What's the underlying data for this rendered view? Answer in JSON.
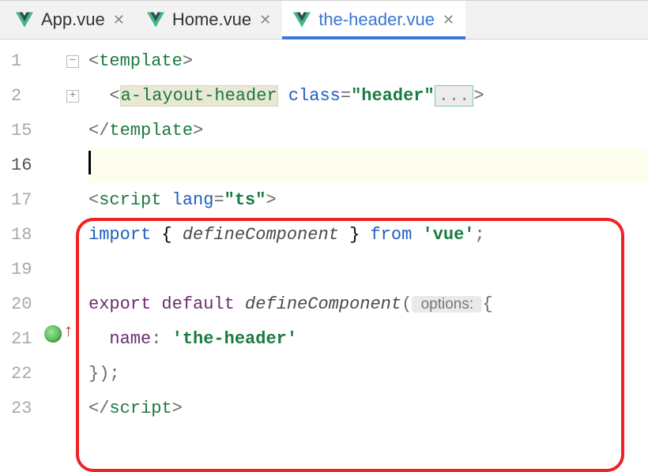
{
  "tabs": [
    {
      "label": "App.vue",
      "active": false
    },
    {
      "label": "Home.vue",
      "active": false
    },
    {
      "label": "the-header.vue",
      "active": true
    }
  ],
  "gutter": {
    "lines": [
      "1",
      "2",
      "15",
      "16",
      "17",
      "18",
      "19",
      "20",
      "21",
      "22",
      "23"
    ],
    "current_index": 3
  },
  "code": {
    "l1": {
      "open": "<",
      "tag": "template",
      "close": ">"
    },
    "l2": {
      "indent": "  ",
      "open": "<",
      "tag": "a-layout-header",
      "sp": " ",
      "attr": "class",
      "eq": "=",
      "val": "\"header\"",
      "fold": "...",
      "close": ">"
    },
    "l15": {
      "open": "</",
      "tag": "template",
      "close": ">"
    },
    "l17": {
      "open": "<",
      "tag": "script",
      "sp": " ",
      "attr": "lang",
      "eq": "=",
      "val": "\"ts\"",
      "close": ">"
    },
    "l18": {
      "kw1": "import",
      "lb": " { ",
      "fn": "defineComponent",
      "rb": " } ",
      "kw2": "from",
      "sp": " ",
      "str": "'vue'",
      "semi": ";"
    },
    "l20": {
      "kw1": "export",
      "sp1": " ",
      "kw2": "default",
      "sp2": " ",
      "fn": "defineComponent",
      "lp": "(",
      "hint": " options: ",
      "ob": "{"
    },
    "l21": {
      "indent": "  ",
      "key": "name",
      "colon": ": ",
      "str": "'the-header'"
    },
    "l22": {
      "close": "});"
    },
    "l23": {
      "open": "</",
      "tag": "script",
      "close": ">"
    }
  }
}
